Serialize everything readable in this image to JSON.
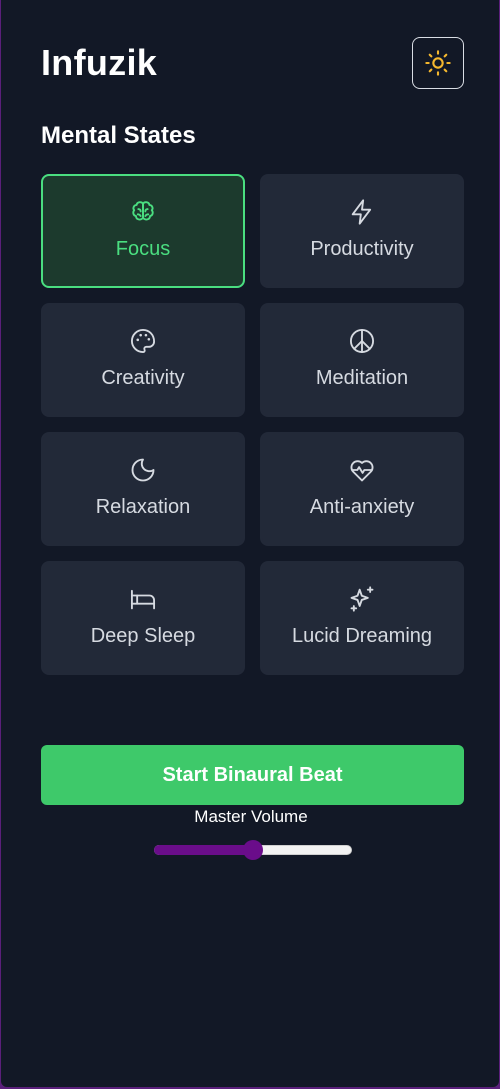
{
  "app": {
    "title": "Infuzik"
  },
  "header": {
    "theme_toggle_icon": "sun-icon",
    "accent": "#f5b82e"
  },
  "section": {
    "title": "Mental States"
  },
  "states": [
    {
      "label": "Focus",
      "icon": "brain-icon",
      "active": true
    },
    {
      "label": "Productivity",
      "icon": "lightning-icon",
      "active": false
    },
    {
      "label": "Creativity",
      "icon": "palette-icon",
      "active": false
    },
    {
      "label": "Meditation",
      "icon": "peace-icon",
      "active": false
    },
    {
      "label": "Relaxation",
      "icon": "moon-icon",
      "active": false
    },
    {
      "label": "Anti-anxiety",
      "icon": "heart-pulse-icon",
      "active": false
    },
    {
      "label": "Deep Sleep",
      "icon": "bed-icon",
      "active": false
    },
    {
      "label": "Lucid Dreaming",
      "icon": "sparkles-icon",
      "active": false
    }
  ],
  "controls": {
    "start_label": "Start Binaural Beat",
    "volume_label": "Master Volume",
    "volume_value": 0.5
  },
  "colors": {
    "background": "#121826",
    "card": "#222938",
    "active_green": "#4ade80",
    "button_green": "#3ec96a",
    "slider_purple": "#6a0d8a"
  }
}
